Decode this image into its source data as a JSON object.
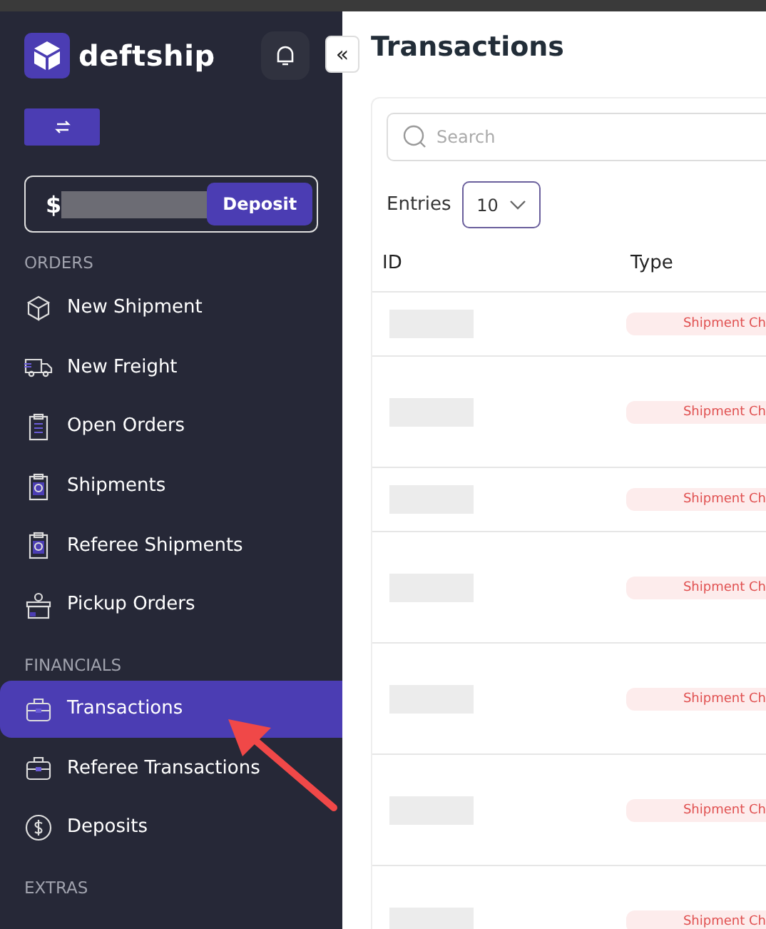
{
  "sidebar": {
    "brand": "deftship",
    "balance": {
      "currency": "$"
    },
    "deposit_button": "Deposit",
    "sections": [
      {
        "title": "ORDERS",
        "items": [
          {
            "label": "New Shipment",
            "kind": "box",
            "selected": false
          },
          {
            "label": "New Freight",
            "kind": "truck",
            "selected": false
          },
          {
            "label": "Open Orders",
            "kind": "clipboard-list",
            "selected": false
          },
          {
            "label": "Shipments",
            "kind": "clipboard-check",
            "selected": false
          },
          {
            "label": "Referee Shipments",
            "kind": "clipboard-check",
            "selected": false
          },
          {
            "label": "Pickup Orders",
            "kind": "gift",
            "selected": false
          }
        ]
      },
      {
        "title": "FINANCIALS",
        "items": [
          {
            "label": "Transactions",
            "kind": "briefcase",
            "selected": true
          },
          {
            "label": "Referee Transactions",
            "kind": "briefcase",
            "selected": false
          },
          {
            "label": "Deposits",
            "kind": "dollar",
            "selected": false
          }
        ]
      },
      {
        "title": "EXTRAS"
      }
    ]
  },
  "collapse_button": "«",
  "page": {
    "title": "Transactions",
    "search": {
      "placeholder": "Search"
    },
    "entries": {
      "label": "Entries",
      "value": "10"
    },
    "table": {
      "columns": [
        "ID",
        "Type"
      ],
      "rows": [
        {
          "kind": "short",
          "type": "Shipment Ch"
        },
        {
          "kind": "tall",
          "type": "Shipment Ch"
        },
        {
          "kind": "short",
          "type": "Shipment Ch"
        },
        {
          "kind": "tall",
          "type": "Shipment Ch"
        },
        {
          "kind": "tall",
          "type": "Shipment Ch"
        },
        {
          "kind": "tall",
          "type": "Shipment Ch"
        },
        {
          "kind": "tall",
          "type": "Shipment Ch"
        }
      ]
    }
  }
}
